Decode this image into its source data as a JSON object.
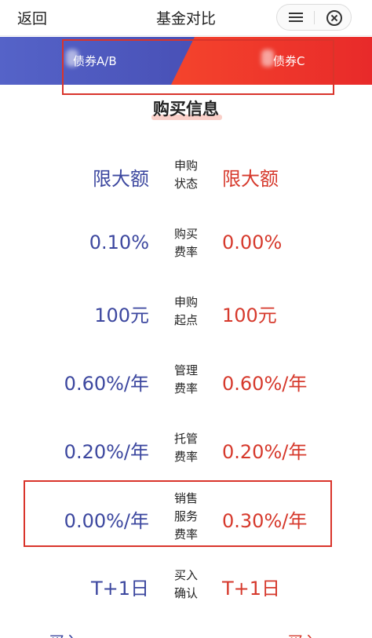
{
  "header": {
    "back_label": "返回",
    "title": "基金对比",
    "icons": [
      "menu-icon",
      "close-circle-icon"
    ]
  },
  "tabs": [
    {
      "label": "债券A/B",
      "color": "#4750b8"
    },
    {
      "label": "债券C",
      "color": "#f0402b"
    }
  ],
  "section": {
    "title": "购买信息"
  },
  "rows": [
    {
      "label_lines": [
        "申购",
        "状态"
      ],
      "left": "限大额",
      "right": "限大额"
    },
    {
      "label_lines": [
        "购买",
        "费率"
      ],
      "left": "0.10%",
      "right": "0.00%"
    },
    {
      "label_lines": [
        "申购",
        "起点"
      ],
      "left": "100元",
      "right": "100元"
    },
    {
      "label_lines": [
        "管理",
        "费率"
      ],
      "left": "0.60%/年",
      "right": "0.60%/年"
    },
    {
      "label_lines": [
        "托管",
        "费率"
      ],
      "left": "0.20%/年",
      "right": "0.20%/年"
    },
    {
      "label_lines": [
        "销售",
        "服务",
        "费率"
      ],
      "left": "0.00%/年",
      "right": "0.30%/年"
    },
    {
      "label_lines": [
        "买入",
        "确认"
      ],
      "left": "T+1日",
      "right": "T+1日"
    }
  ],
  "partial_row": {
    "left": "买入",
    "right": "买入"
  },
  "colors": {
    "left_fund": "#3c479f",
    "right_fund": "#d6392c",
    "highlight": "#d9342b"
  }
}
